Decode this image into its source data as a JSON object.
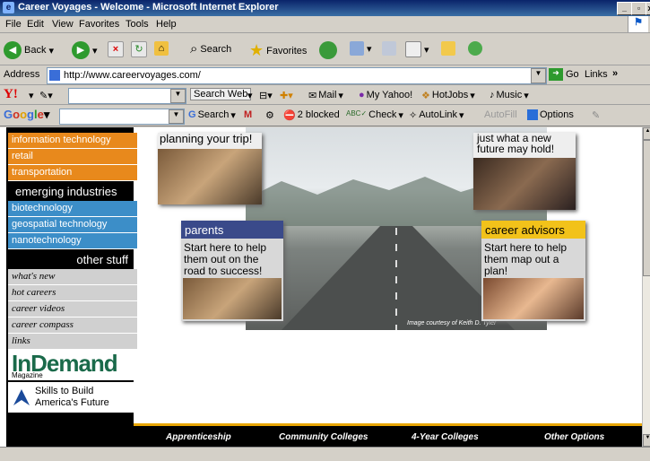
{
  "window": {
    "title": "Career Voyages - Welcome - Microsoft Internet Explorer"
  },
  "menu": [
    "File",
    "Edit",
    "View",
    "Favorites",
    "Tools",
    "Help"
  ],
  "toolbar": {
    "back": "Back",
    "search": "Search",
    "favorites": "Favorites"
  },
  "address": {
    "label": "Address",
    "url": "http://www.careervoyages.com/",
    "go": "Go",
    "links": "Links"
  },
  "yahoo": {
    "search_web": "Search Web",
    "mail": "Mail",
    "my_yahoo": "My Yahoo!",
    "hotjobs": "HotJobs",
    "music": "Music"
  },
  "google": {
    "search": "Search",
    "blocked": "2 blocked",
    "check": "Check",
    "autolink": "AutoLink",
    "autofill": "AutoFill",
    "options": "Options"
  },
  "leftnav": {
    "orange_items": [
      "information technology",
      "retail",
      "transportation"
    ],
    "emerging_heading": "emerging industries",
    "blue_items": [
      "biotechnology",
      "geospatial technology",
      "nanotechnology"
    ],
    "other_heading": "other stuff",
    "grey_items": [
      "what's new",
      "hot careers",
      "career videos",
      "career compass",
      "links"
    ],
    "indemand_big": "InDemand",
    "indemand_small": "Magazine",
    "skills_line1": "Skills to Build",
    "skills_line2": "America's Future"
  },
  "hero": {
    "top_left_text": "planning your trip!",
    "top_right_line1": "just what a new",
    "top_right_line2": "future may hold!",
    "parents_title": "parents",
    "parents_text": "Start here to help them out on the road to success!",
    "advisors_title": "career advisors",
    "advisors_text": "Start here to help them map out a plan!",
    "credit": "Image courtesy of Keith D. Tyler"
  },
  "bottomnav": [
    "Apprenticeship",
    "Community Colleges",
    "4-Year Colleges",
    "Other Options"
  ],
  "colors": {
    "orange": "#e8891c",
    "blue": "#3c8ec8",
    "gold": "#e8a600",
    "navy": "#3a4a8a"
  }
}
